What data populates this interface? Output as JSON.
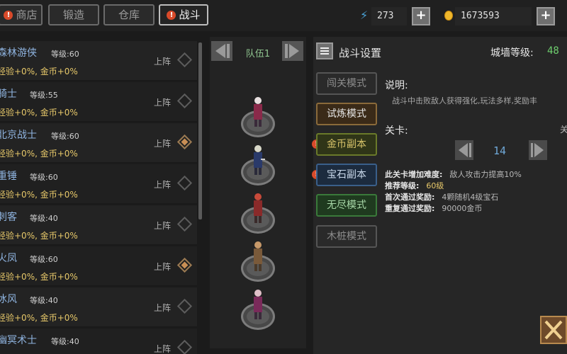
{
  "tabs": [
    {
      "label": "商店",
      "alert": true,
      "active": false
    },
    {
      "label": "锻造",
      "alert": false,
      "active": false
    },
    {
      "label": "仓库",
      "alert": false,
      "active": false
    },
    {
      "label": "战斗",
      "alert": true,
      "active": true
    }
  ],
  "resources": {
    "energy": "273",
    "gold": "1673593",
    "plus": "+"
  },
  "heroes": [
    {
      "name": "森林游侠",
      "level": "等级:60",
      "bonus": "经验+0%, 金币+0%",
      "action": "上阵",
      "deployed": false
    },
    {
      "name": "骑士",
      "level": "等级:55",
      "bonus": "经验+0%, 金币+0%",
      "action": "上阵",
      "deployed": false
    },
    {
      "name": "北京战士",
      "level": "等级:60",
      "bonus": "经验+0%, 金币+0%",
      "action": "上阵",
      "deployed": true
    },
    {
      "name": "重锤",
      "level": "等级:60",
      "bonus": "经验+0%, 金币+0%",
      "action": "上阵",
      "deployed": false
    },
    {
      "name": "刺客",
      "level": "等级:40",
      "bonus": "经验+0%, 金币+0%",
      "action": "上阵",
      "deployed": false
    },
    {
      "name": "火凤",
      "level": "等级:60",
      "bonus": "经验+0%, 金币+0%",
      "action": "上阵",
      "deployed": true
    },
    {
      "name": "冰风",
      "level": "等级:40",
      "bonus": "经验+0%, 金币+0%",
      "action": "上阵",
      "deployed": false
    },
    {
      "name": "幽冥术士",
      "level": "等级:40",
      "bonus": "",
      "action": "上阵",
      "deployed": false
    }
  ],
  "team": {
    "label": "队伍1",
    "members": [
      {
        "color": "#8a2a4a"
      },
      {
        "color": "#2a3a6a"
      },
      {
        "color": "#8a2a2a"
      },
      {
        "color": "#7a5a3a"
      },
      {
        "color": "#7a2a5a"
      }
    ]
  },
  "settings": {
    "title": "战斗设置",
    "wall_label": "城墙等级:",
    "wall_level": "48",
    "modes": [
      {
        "label": "闯关模式",
        "style": "",
        "alert": false
      },
      {
        "label": "试炼模式",
        "style": "trial",
        "alert": false
      },
      {
        "label": "金币副本",
        "style": "gold",
        "alert": true
      },
      {
        "label": "宝石副本",
        "style": "gem",
        "alert": true
      },
      {
        "label": "无尽模式",
        "style": "endless",
        "alert": false
      },
      {
        "label": "木桩模式",
        "style": "",
        "alert": false
      }
    ],
    "desc_label": "说明:",
    "desc_text": "战斗中击败敌人获得强化,玩法多样,奖励丰",
    "stage_label": "关卡:",
    "stage_extra": "关",
    "stage_value": "14",
    "info": [
      {
        "key": "此关卡增加难度:",
        "value": "敌人攻击力提高10%",
        "highlight": false
      },
      {
        "key": "推荐等级:",
        "value": "60级",
        "highlight": true
      },
      {
        "key": "首次通过奖励:",
        "value": "4颗随机4级宝石",
        "highlight": false
      },
      {
        "key": "重复通过奖励:",
        "value": "90000金币",
        "highlight": false
      }
    ]
  }
}
